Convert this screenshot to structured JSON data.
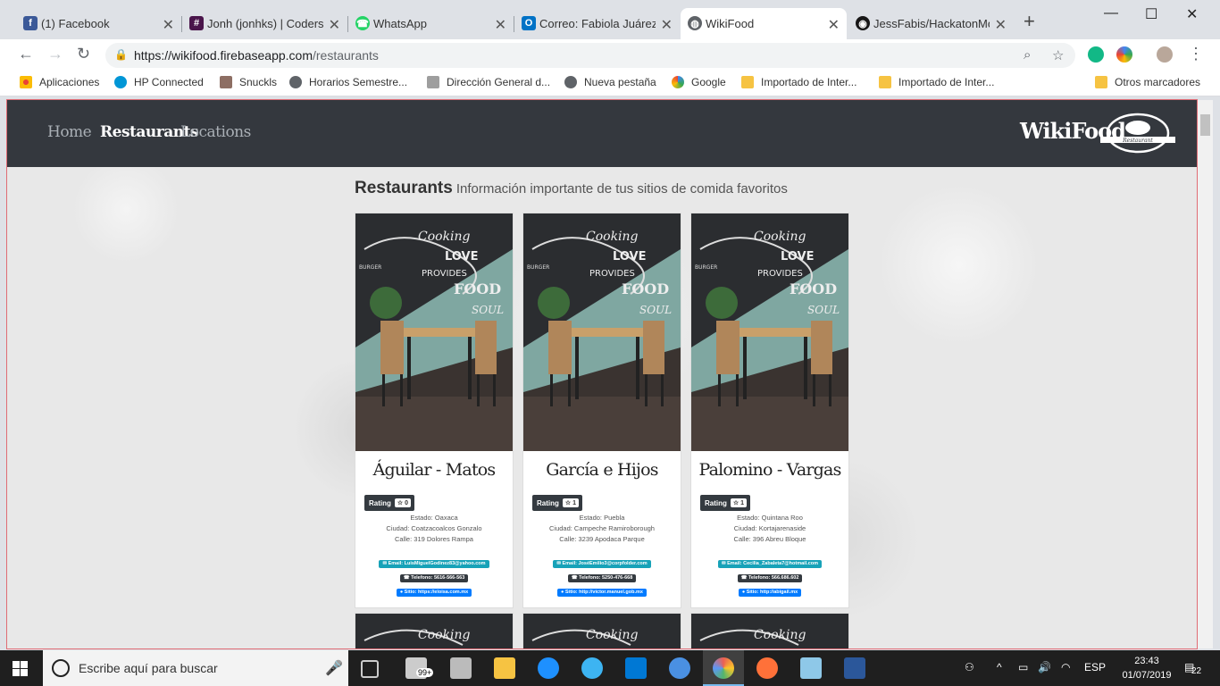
{
  "tabs": [
    {
      "title": "(1) Facebook",
      "favicon": "facebook-icon",
      "color": "#3b5998"
    },
    {
      "title": "Jonh (jonhks) | Coders",
      "favicon": "slack-icon",
      "color": "#4a154b"
    },
    {
      "title": "WhatsApp",
      "favicon": "whatsapp-icon",
      "color": "#25d366"
    },
    {
      "title": "Correo: Fabiola Juárez",
      "favicon": "outlook-icon",
      "color": "#0072c6"
    },
    {
      "title": "WikiFood",
      "favicon": "globe-icon",
      "color": "#5f6368",
      "active": true
    },
    {
      "title": "JessFabis/HackatonMo",
      "favicon": "github-icon",
      "color": "#181717"
    }
  ],
  "address": {
    "host": "https://wikifood.firebaseapp.com",
    "path": "/restaurants"
  },
  "bookmarks": [
    {
      "label": "Aplicaciones",
      "icon": "apps-grid-icon",
      "color": "#ea4335"
    },
    {
      "label": "HP Connected",
      "icon": "hp-icon",
      "color": "#0096d6"
    },
    {
      "label": "Snuckls",
      "icon": "snuckls-icon",
      "color": "#8d6e63"
    },
    {
      "label": "Horarios Semestre...",
      "icon": "globe-icon",
      "color": "#5f6368"
    },
    {
      "label": "Dirección General d...",
      "icon": "dgd-icon",
      "color": "#9e9e9e"
    },
    {
      "label": "Nueva pestaña",
      "icon": "globe-icon",
      "color": "#5f6368"
    },
    {
      "label": "Google",
      "icon": "google-icon",
      "color": "#4285f4"
    },
    {
      "label": "Importado de Inter...",
      "icon": "folder-icon",
      "color": "#f6c342"
    },
    {
      "label": "Importado de Inter...",
      "icon": "folder-icon",
      "color": "#f6c342"
    },
    {
      "label": "Otros marcadores",
      "icon": "folder-icon",
      "color": "#f6c342"
    }
  ],
  "site": {
    "nav": {
      "home": "Home",
      "restaurants": "Restaurants",
      "locations": "Locations"
    },
    "brand": "WikiFood",
    "logo_text": "Restaurant",
    "heading": {
      "title": "Restaurants",
      "subtitle": "Información importante de tus sitios de comida favoritos"
    },
    "cards": [
      {
        "name": "Águilar - Matos",
        "rating_label": "Rating",
        "rating": "0",
        "estado": "Estado: Oaxaca",
        "ciudad": "Ciudad: Coatzacoalcos Gonzalo",
        "calle": "Calle: 319 Dolores Rampa",
        "email": "✉ Email: LuisMiguelGodinez83@yahoo.com",
        "telefono": "☎ Telefono: 5616-566-563",
        "sitio": "● Sitio: https://eloisa.com.mx"
      },
      {
        "name": "García e Hijos",
        "rating_label": "Rating",
        "rating": "1",
        "estado": "Estado: Puebla",
        "ciudad": "Ciudad: Campeche Ramiroborough",
        "calle": "Calle: 3239 Apodaca Parque",
        "email": "✉ Email: JoséEmilio3@corpfolder.com",
        "telefono": "☎ Telefono: 5250-476-668",
        "sitio": "● Sitio: http://victor.manuel.gob.mx"
      },
      {
        "name": "Palomino - Vargas",
        "rating_label": "Rating",
        "rating": "1",
        "estado": "Estado: Quintana Roo",
        "ciudad": "Ciudad: Kortajarenaside",
        "calle": "Calle: 396 Abreu Bloque",
        "email": "✉ Email: Cecilia_Zabaleta7@hotmail.com",
        "telefono": "☎ Telefono: 566.686.602",
        "sitio": "● Sitio: http://abigail.mx"
      }
    ],
    "image_text": [
      "Cooking",
      "with",
      "LOVE",
      "PROVIDES",
      "FOOD",
      "for the",
      "SOUL",
      "BURGER",
      "BURGER SOLID"
    ]
  },
  "taskbar": {
    "search_placeholder": "Escribe aquí para buscar",
    "mail_badge": "99+",
    "language": "ESP",
    "time": "23:43",
    "date": "01/07/2019",
    "notifications": "22"
  }
}
